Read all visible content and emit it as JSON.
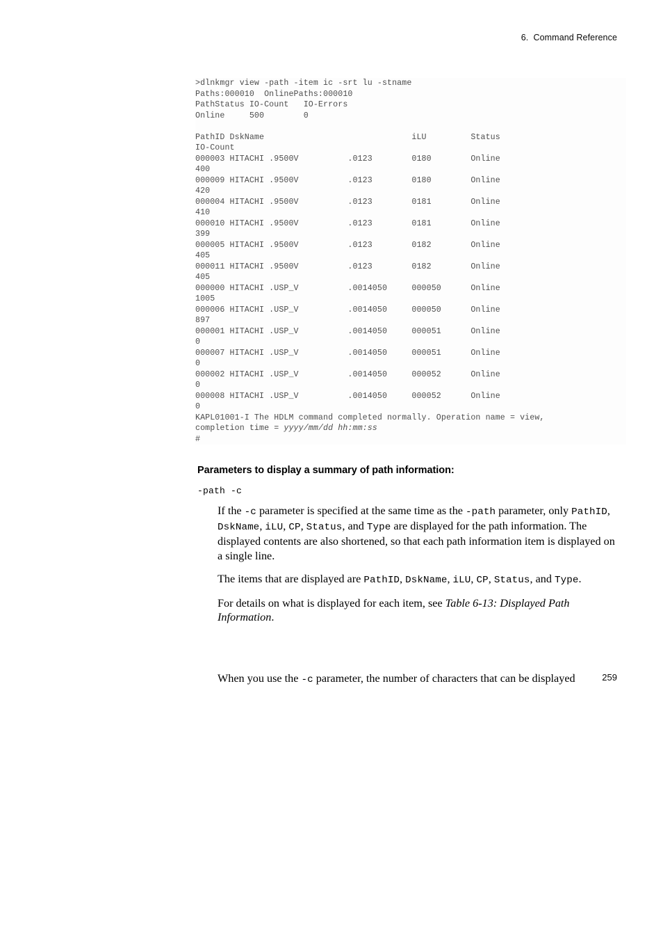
{
  "header": {
    "chapter_ref": "6.  Command Reference"
  },
  "console": {
    "lines": [
      ">dlnkmgr view -path -item ic -srt lu -stname",
      "Paths:000010  OnlinePaths:000010",
      "PathStatus IO-Count   IO-Errors",
      "Online     500        0",
      "",
      "PathID DskName                              iLU         Status",
      "IO-Count",
      "000003 HITACHI .9500V          .0123        0180        Online",
      "400",
      "000009 HITACHI .9500V          .0123        0180        Online",
      "420",
      "000004 HITACHI .9500V          .0123        0181        Online",
      "410",
      "000010 HITACHI .9500V          .0123        0181        Online",
      "399",
      "000005 HITACHI .9500V          .0123        0182        Online",
      "405",
      "000011 HITACHI .9500V          .0123        0182        Online",
      "405",
      "000000 HITACHI .USP_V          .0014050     000050      Online",
      "1005",
      "000006 HITACHI .USP_V          .0014050     000050      Online",
      "897",
      "000001 HITACHI .USP_V          .0014050     000051      Online",
      "0",
      "000007 HITACHI .USP_V          .0014050     000051      Online",
      "0",
      "000002 HITACHI .USP_V          .0014050     000052      Online",
      "0",
      "000008 HITACHI .USP_V          .0014050     000052      Online",
      "0"
    ],
    "completion_message_part1": "KAPL01001-I The HDLM command completed normally. Operation name = view,",
    "completion_message_part2": "completion time = ",
    "completion_timestamp": "yyyy/mm/dd hh:mm:ss",
    "prompt": "#"
  },
  "section": {
    "heading": "Parameters to display a summary of path information:",
    "parameter": "-path -c",
    "paragraph1": {
      "t1": "If the ",
      "c1": "-c",
      "t2": " parameter is specified at the same time as the ",
      "c2": "-path",
      "t3": " parameter, only ",
      "c3": "PathID",
      "t4": ", ",
      "c4": "DskName",
      "t5": ", ",
      "c5": "iLU",
      "t6": ", ",
      "c6": "CP",
      "t7": ", ",
      "c7": "Status",
      "t8": ", and ",
      "c8": "Type",
      "t9": " are displayed for the path information. The displayed contents are also shortened, so that each path information item is displayed on a single line."
    },
    "paragraph2": {
      "t1": "The items that are displayed are ",
      "c1": "PathID",
      "t2": ", ",
      "c2": "DskName",
      "t3": ", ",
      "c3": "iLU",
      "t4": ", ",
      "c4": "CP",
      "t5": ", ",
      "c5": "Status",
      "t6": ", and ",
      "c6": "Type",
      "t7": "."
    },
    "paragraph3": {
      "t1": "For details on what is displayed for each item, see ",
      "i1": "Table  6-13:  Displayed Path Information",
      "t2": "."
    },
    "paragraph4": {
      "t1": "When you use the ",
      "c1": "-c",
      "t2": " parameter, the number of characters that can be displayed"
    }
  },
  "footer": {
    "page_number": "259"
  }
}
